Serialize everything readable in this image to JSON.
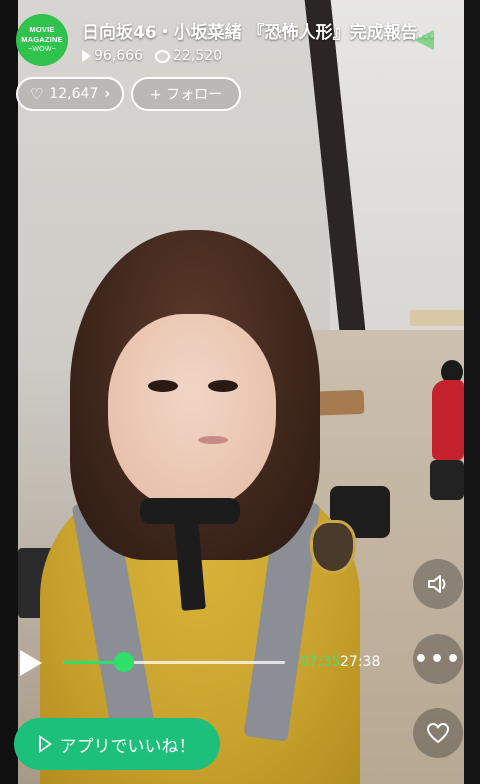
{
  "channel": {
    "logo_line1": "MOVIE",
    "logo_line2": "MAGAZINE",
    "logo_line3": "~WOW~"
  },
  "video": {
    "title": "日向坂46・小坂菜緒 『恐怖人形』完成報告…",
    "views": "96,666",
    "comments": "22,520"
  },
  "actions": {
    "likes_label": "12,647",
    "follow_label": "+ フォロー"
  },
  "player": {
    "current_time": "07:35",
    "duration": "27:38",
    "progress": 0.274
  },
  "cta": {
    "label": "アプリでいいね！"
  },
  "colors": {
    "accent": "#2ee06a",
    "cta": "#1cc07a",
    "logo": "#2fc24c"
  },
  "icons": [
    "play-icon",
    "comment-icon",
    "heart-icon",
    "chevron-right-icon",
    "volume-icon",
    "more-icon"
  ]
}
